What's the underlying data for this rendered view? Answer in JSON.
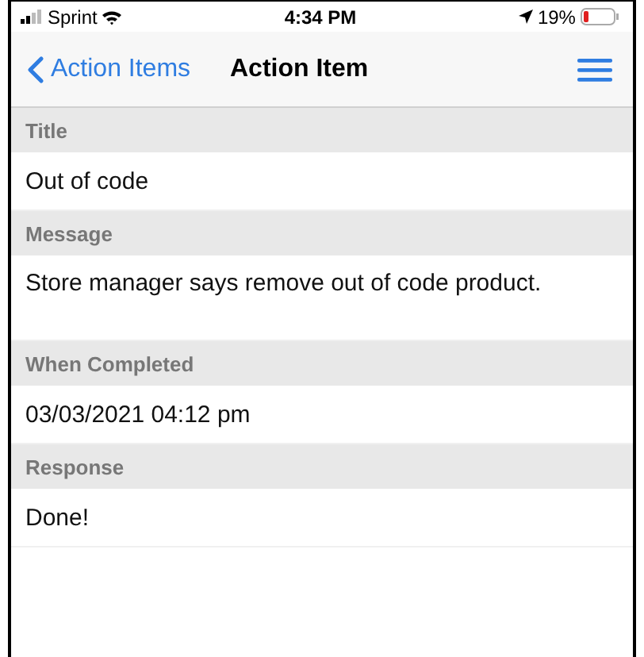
{
  "status_bar": {
    "carrier": "Sprint",
    "time": "4:34 PM",
    "battery": "19%"
  },
  "nav_bar": {
    "back": "Action Items",
    "title": "Action Item"
  },
  "sections": [
    {
      "header": "Title",
      "value": "Out of code",
      "spacer": false
    },
    {
      "header": "Message",
      "value": "Store manager says remove out of code product.",
      "spacer": true
    },
    {
      "header": "When Completed",
      "value": "03/03/2021 04:12 pm",
      "spacer": false
    },
    {
      "header": "Response",
      "value": "Done!",
      "spacer": false
    }
  ]
}
